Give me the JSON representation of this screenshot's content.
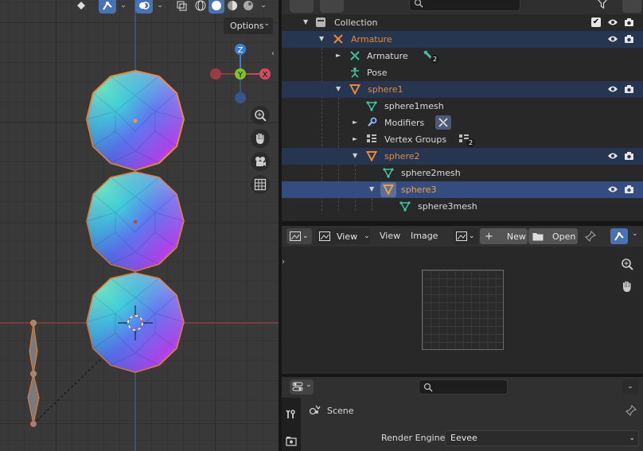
{
  "viewport": {
    "options_label": "Options",
    "gizmo_axes": [
      "Z",
      "Y",
      "X"
    ],
    "objects": [
      "sphere1",
      "sphere2",
      "sphere3"
    ]
  },
  "outliner": {
    "rows": [
      {
        "label": "Collection",
        "type": "collection"
      },
      {
        "label": "Armature",
        "type": "armature-object",
        "color": "#e8892f"
      },
      {
        "label": "Armature",
        "type": "armature-data",
        "badge": "2"
      },
      {
        "label": "Pose",
        "type": "pose"
      },
      {
        "label": "sphere1",
        "type": "mesh-object",
        "color": "#e8892f"
      },
      {
        "label": "sphere1mesh",
        "type": "mesh-data"
      },
      {
        "label": "Modifiers",
        "type": "modifiers"
      },
      {
        "label": "Vertex Groups",
        "type": "vertex-groups",
        "badge": "2"
      },
      {
        "label": "sphere2",
        "type": "mesh-object",
        "color": "#e8892f"
      },
      {
        "label": "sphere2mesh",
        "type": "mesh-data"
      },
      {
        "label": "sphere3",
        "type": "mesh-object",
        "color": "#e8892f"
      },
      {
        "label": "sphere3mesh",
        "type": "mesh-data"
      }
    ]
  },
  "image_editor": {
    "view_dropdown": "View",
    "menu_view": "View",
    "menu_image": "Image",
    "new_label": "New",
    "open_label": "Open"
  },
  "properties": {
    "scene_label": "Scene",
    "render_engine_label": "Render Engine",
    "render_engine_value": "Eevee"
  },
  "colors": {
    "accent": "#4772b3",
    "selected_orange": "#e8892f",
    "outliner_selected": "#263651",
    "outliner_active": "#334d80"
  }
}
